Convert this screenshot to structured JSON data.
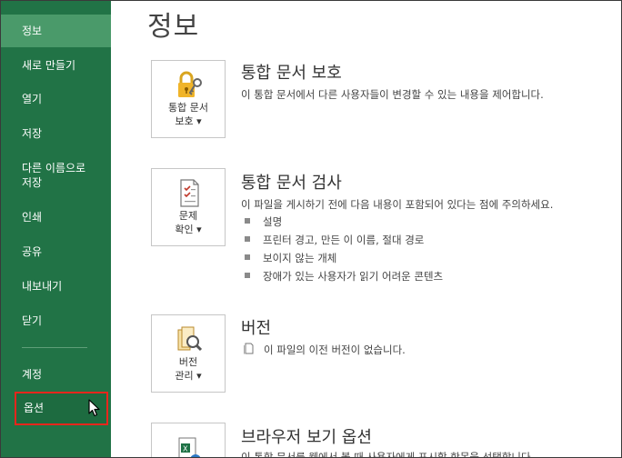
{
  "sidebar": {
    "items": [
      {
        "label": "정보",
        "selected": true
      },
      {
        "label": "새로 만들기"
      },
      {
        "label": "열기"
      },
      {
        "label": "저장"
      },
      {
        "label": "다른 이름으로"
      },
      {
        "label": "저장"
      },
      {
        "label": "인쇄"
      },
      {
        "label": "공유"
      },
      {
        "label": "내보내기"
      },
      {
        "label": "닫기"
      },
      {
        "label": "계정"
      },
      {
        "label": "옵션",
        "highlighted": true
      }
    ]
  },
  "main": {
    "title": "정보",
    "protect": {
      "tile_line1": "통합 문서",
      "tile_line2": "보호",
      "title": "통합 문서 보호",
      "desc": "이 통합 문서에서 다른 사용자들이 변경할 수 있는 내용을 제어합니다."
    },
    "inspect": {
      "tile_line1": "문제",
      "tile_line2": "확인",
      "title": "통합 문서 검사",
      "desc": "이 파일을 게시하기 전에 다음 내용이 포함되어 있다는 점에 주의하세요.",
      "bullets": [
        "설명",
        "프린터 경고, 만든 이 이름, 절대 경로",
        "보이지 않는 개체",
        "장애가 있는 사용자가 읽기 어려운 콘텐츠"
      ]
    },
    "versions": {
      "tile_line1": "버전",
      "tile_line2": "관리",
      "title": "버전",
      "desc": "이 파일의 이전 버전이 없습니다."
    },
    "browser": {
      "title": "브라우저 보기 옵션",
      "desc": "이 통합 문서를 웹에서 볼 때 사용자에게 표시할 항목을 선택합니다."
    }
  },
  "colors": {
    "sidebar_bg": "#217346",
    "sidebar_selected": "#4a9a6a",
    "options_highlight_border": "#e8261c"
  }
}
